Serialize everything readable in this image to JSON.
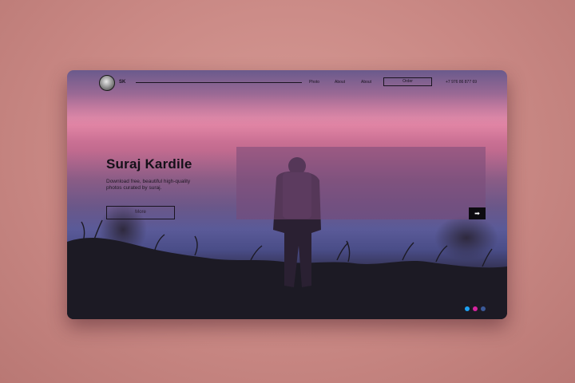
{
  "brand": {
    "initials": "SK"
  },
  "nav": {
    "links": [
      "Photo",
      "About",
      "About"
    ],
    "order_label": "Order",
    "phone": "+7 976 86 877 69"
  },
  "hero": {
    "title": "Suraj Kardile",
    "subtitle": "Download free, beautiful high-quality photos curated by suraj.",
    "more_label": "More",
    "arrow": "➡"
  },
  "social": {
    "icons": [
      "twitter-icon",
      "instagram-icon",
      "facebook-icon"
    ],
    "colors": [
      "#1da1f2",
      "#d6249f",
      "#3b5998"
    ]
  },
  "colors": {
    "page_background": "#c98884",
    "overlay_panel": "#784b78",
    "text_dark": "#1a1420"
  }
}
